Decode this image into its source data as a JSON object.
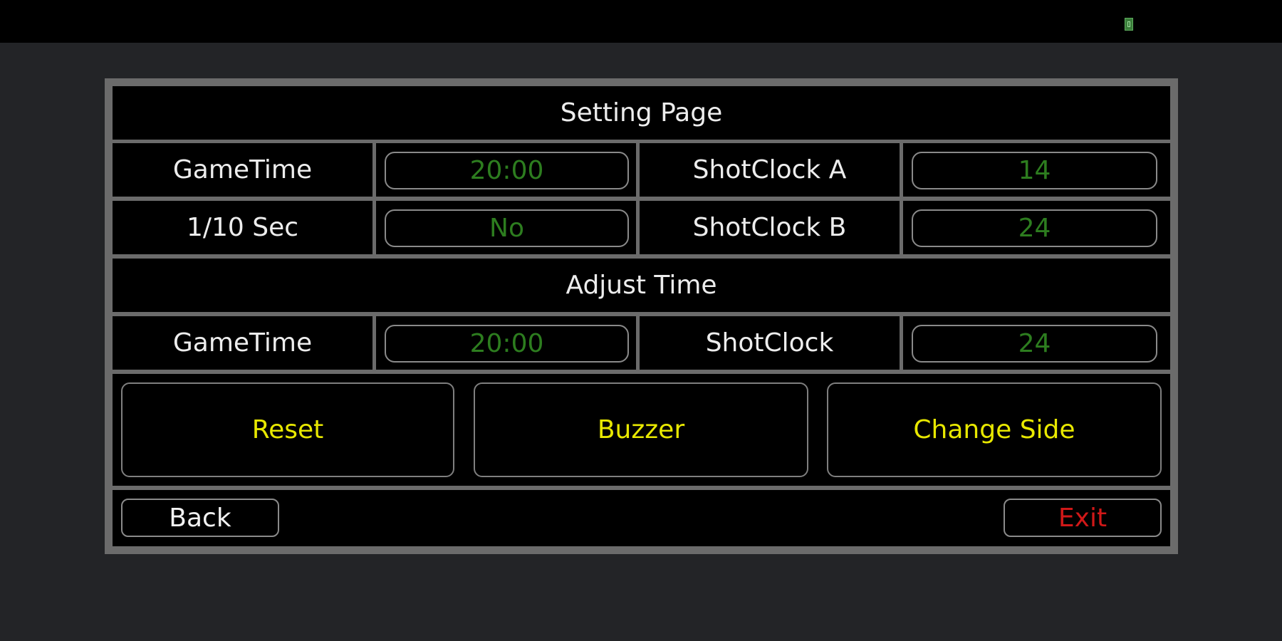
{
  "status_bar": {
    "battery_icon": "battery-icon"
  },
  "settings": {
    "title": "Setting Page",
    "game_time_label": "GameTime",
    "game_time_value": "20:00",
    "shot_clock_a_label": "ShotClock A",
    "shot_clock_a_value": "14",
    "tenth_sec_label": "1/10 Sec",
    "tenth_sec_value": "No",
    "shot_clock_b_label": "ShotClock B",
    "shot_clock_b_value": "24"
  },
  "adjust": {
    "title": "Adjust Time",
    "game_time_label": "GameTime",
    "game_time_value": "20:00",
    "shot_clock_label": "ShotClock",
    "shot_clock_value": "24"
  },
  "actions": {
    "reset_label": "Reset",
    "buzzer_label": "Buzzer",
    "change_side_label": "Change Side"
  },
  "nav": {
    "back_label": "Back",
    "exit_label": "Exit"
  },
  "colors": {
    "value_green": "#2d7d1f",
    "action_yellow": "#e8e800",
    "exit_red": "#d01818",
    "border_gray": "#6b6b6b"
  }
}
